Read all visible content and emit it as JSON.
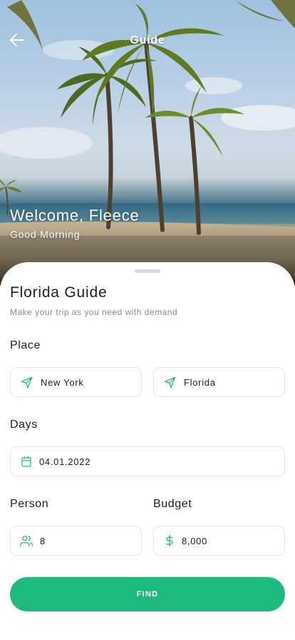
{
  "header": {
    "title": "Guide",
    "welcome": "Welcome, Fleece",
    "greeting": "Good Morning"
  },
  "sheet": {
    "title": "Florida Guide",
    "subtitle": "Make your trip as you need with demand"
  },
  "place": {
    "label": "Place",
    "from": "New York",
    "to": "Florida"
  },
  "days": {
    "label": "Days",
    "date": "04.01.2022"
  },
  "person": {
    "label": "Person",
    "value": "8"
  },
  "budget": {
    "label": "Budget",
    "value": "8,000"
  },
  "actions": {
    "find_label": "FIND"
  },
  "colors": {
    "accent": "#1dba7e",
    "icon": "#1dba7e"
  },
  "icons": [
    "back-arrow-icon",
    "send-icon",
    "calendar-icon",
    "users-icon",
    "dollar-icon"
  ]
}
